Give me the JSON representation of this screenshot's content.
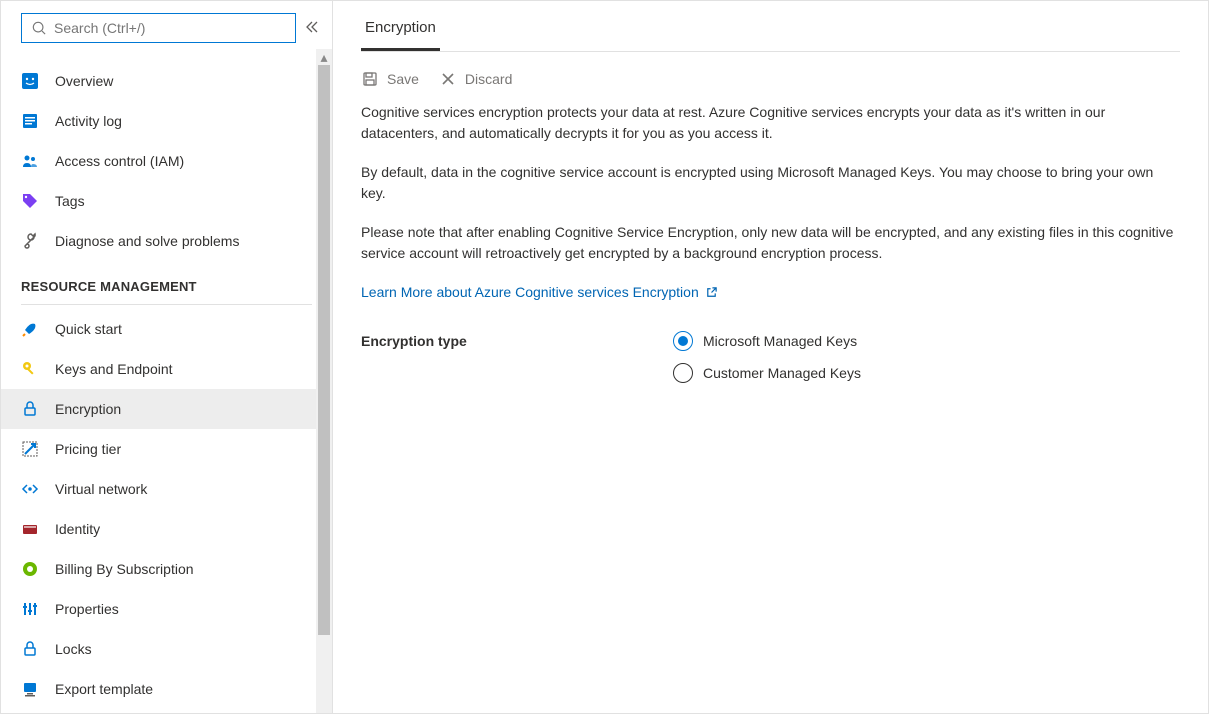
{
  "search": {
    "placeholder": "Search (Ctrl+/)"
  },
  "sidebar": {
    "items": [
      {
        "label": "Overview"
      },
      {
        "label": "Activity log"
      },
      {
        "label": "Access control (IAM)"
      },
      {
        "label": "Tags"
      },
      {
        "label": "Diagnose and solve problems"
      }
    ],
    "section_header": "RESOURCE MANAGEMENT",
    "rm_items": [
      {
        "label": "Quick start"
      },
      {
        "label": "Keys and Endpoint"
      },
      {
        "label": "Encryption"
      },
      {
        "label": "Pricing tier"
      },
      {
        "label": "Virtual network"
      },
      {
        "label": "Identity"
      },
      {
        "label": "Billing By Subscription"
      },
      {
        "label": "Properties"
      },
      {
        "label": "Locks"
      },
      {
        "label": "Export template"
      }
    ]
  },
  "tabs": {
    "active": "Encryption"
  },
  "toolbar": {
    "save": "Save",
    "discard": "Discard"
  },
  "content": {
    "p1": "Cognitive services encryption protects your data at rest. Azure Cognitive services encrypts your data as it's written in our datacenters, and automatically decrypts it for you as you access it.",
    "p2": "By default, data in the cognitive service account is encrypted using Microsoft Managed Keys. You may choose to bring your own key.",
    "p3": "Please note that after enabling Cognitive Service Encryption, only new data will be encrypted, and any existing files in this cognitive service account will retroactively get encrypted by a background encryption process.",
    "link": "Learn More about Azure Cognitive services Encryption"
  },
  "form": {
    "label": "Encryption type",
    "options": [
      {
        "label": "Microsoft Managed Keys"
      },
      {
        "label": "Customer Managed Keys"
      }
    ]
  }
}
